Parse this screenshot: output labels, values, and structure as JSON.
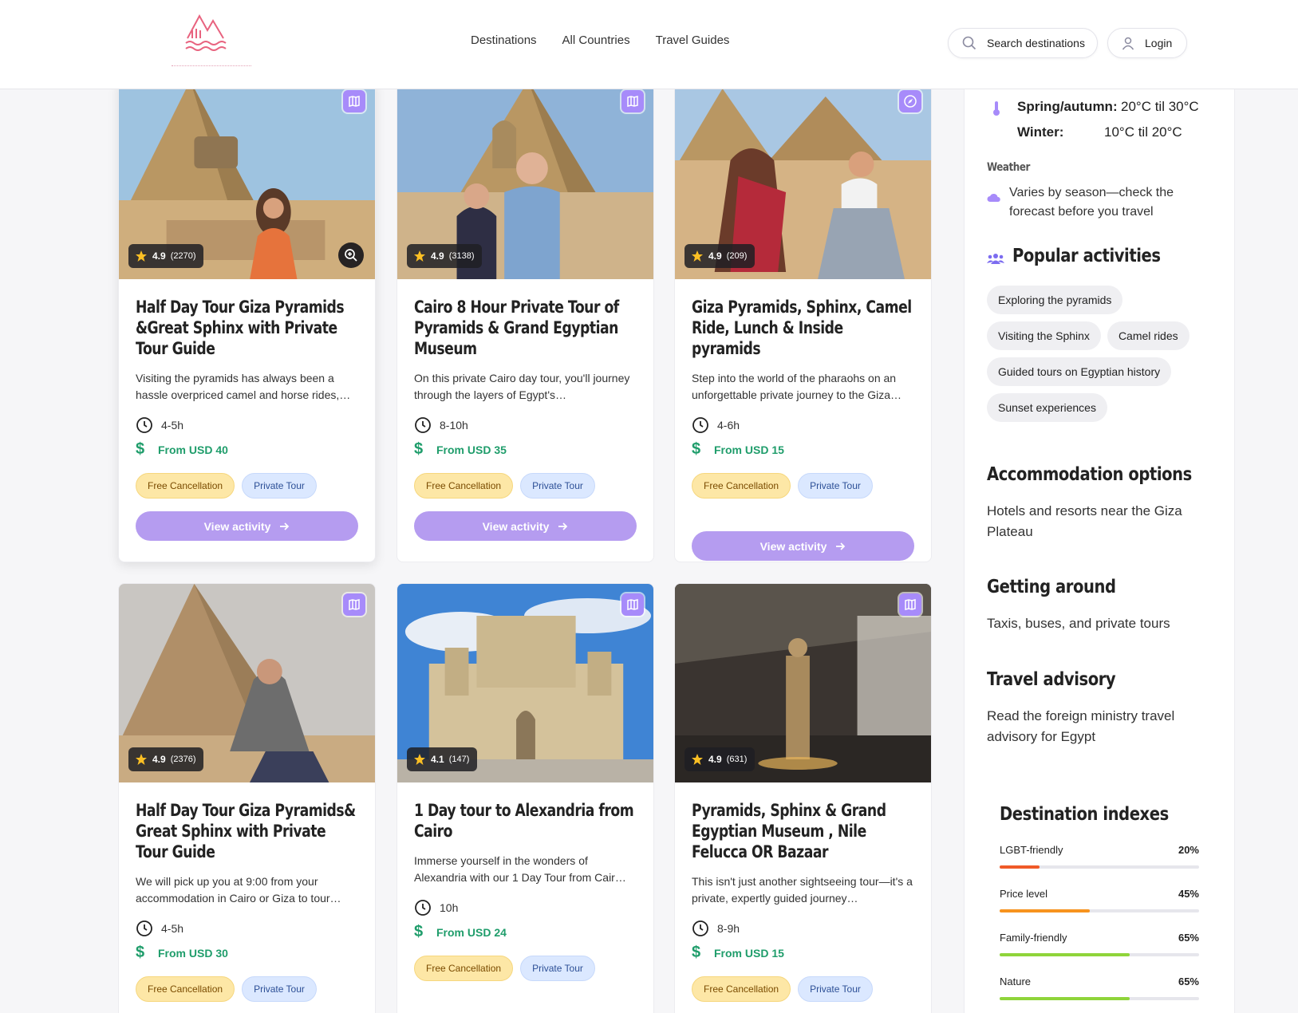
{
  "header": {
    "nav": [
      "Destinations",
      "All Countries",
      "Travel Guides"
    ],
    "search_label": "Search destinations",
    "login_label": "Login"
  },
  "cards": [
    {
      "title": "Half Day Tour Giza Pyramids &Great Sphinx with Private Tour Guide",
      "rating": "4.9",
      "reviews": "(2270)",
      "description": "Visiting the pyramids has always been a hassle overpriced camel and horse rides,…",
      "duration": "4-5h",
      "price": "From USD 40",
      "tags": [
        "Free Cancellation",
        "Private Tour"
      ],
      "cta": "View activity",
      "corner_icon": "map-icon"
    },
    {
      "title": "Cairo 8 Hour Private Tour of Pyramids & Grand Egyptian Museum",
      "rating": "4.9",
      "reviews": "(3138)",
      "description": "On this private Cairo day tour, you'll journey through the layers of Egypt's…",
      "duration": "8-10h",
      "price": "From USD 35",
      "tags": [
        "Free Cancellation",
        "Private Tour"
      ],
      "cta": "View activity",
      "corner_icon": "map-icon"
    },
    {
      "title": "Giza Pyramids, Sphinx, Camel Ride, Lunch & Inside pyramids",
      "rating": "4.9",
      "reviews": "(209)",
      "description": "Step into the world of the pharaohs on an unforgettable private journey to the Giza…",
      "duration": "4-6h",
      "price": "From USD 15",
      "tags": [
        "Free Cancellation",
        "Private Tour"
      ],
      "cta": "View activity",
      "corner_icon": "compass-icon"
    },
    {
      "title": "Half Day Tour Giza Pyramids& Great Sphinx with Private Tour Guide",
      "rating": "4.9",
      "reviews": "(2376)",
      "description": "We will pick up you at 9:00 from your accommodation in Cairo or Giza to tour…",
      "duration": "4-5h",
      "price": "From USD 30",
      "tags": [
        "Free Cancellation",
        "Private Tour"
      ],
      "corner_icon": "map-icon"
    },
    {
      "title": "1 Day tour to Alexandria from Cairo",
      "rating": "4.1",
      "reviews": "(147)",
      "description": "Immerse yourself in the wonders of Alexandria with our 1 Day Tour from Cair…",
      "duration": "10h",
      "price": "From USD 24",
      "tags": [
        "Free Cancellation",
        "Private Tour"
      ],
      "corner_icon": "map-icon"
    },
    {
      "title": "Pyramids, Sphinx & Grand Egyptian Museum , Nile Felucca OR Bazaar",
      "rating": "4.9",
      "reviews": "(631)",
      "description": "This isn't just another sightseeing tour—it's a private, expertly guided journey…",
      "duration": "8-9h",
      "price": "From USD 15",
      "tags": [
        "Free Cancellation",
        "Private Tour"
      ],
      "corner_icon": "map-icon"
    }
  ],
  "sidebar": {
    "climate": [
      {
        "label": "Spring/autumn:",
        "value": "20°C til 30°C"
      },
      {
        "label": "Winter:",
        "value": "10°C til 20°C"
      }
    ],
    "weather_heading": "Weather",
    "weather_text": "Varies by season—check the forecast before you travel",
    "activities_heading": "Popular activities",
    "activities": [
      "Exploring the pyramids",
      "Visiting the Sphinx",
      "Camel rides",
      "Guided tours on Egyptian history",
      "Sunset experiences"
    ],
    "accommodation_heading": "Accommodation options",
    "accommodation_text": "Hotels and resorts near the Giza Plateau",
    "getting_around_heading": "Getting around",
    "getting_around_text": "Taxis, buses, and private tours",
    "advisory_heading": "Travel advisory",
    "advisory_text": "Read the foreign ministry travel advisory for Egypt",
    "indexes_heading": "Destination indexes",
    "indexes": [
      {
        "label": "LGBT-friendly",
        "pct_label": "20%",
        "value": 0.2,
        "color": "#f05a28"
      },
      {
        "label": "Price level",
        "pct_label": "45%",
        "value": 0.45,
        "color": "#f7931e"
      },
      {
        "label": "Family-friendly",
        "pct_label": "65%",
        "value": 0.65,
        "color": "#8fd43a"
      },
      {
        "label": "Nature",
        "pct_label": "65%",
        "value": 0.65,
        "color": "#8fd43a"
      }
    ]
  },
  "colors": {
    "accent": "#b59cf0",
    "price_green": "#1f9d6b",
    "map_icon": "#a78bfa"
  }
}
